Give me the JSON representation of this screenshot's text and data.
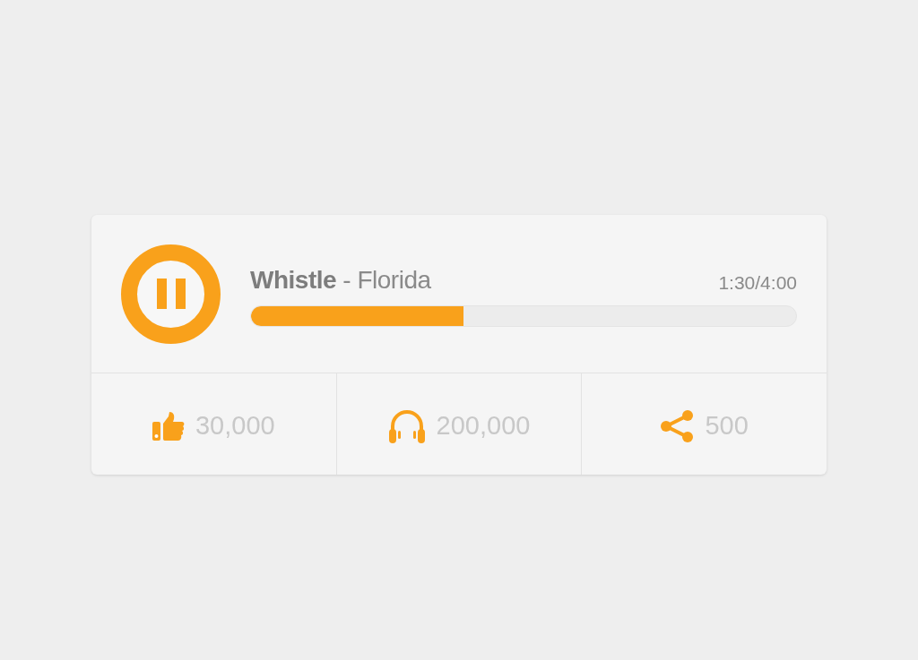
{
  "player": {
    "playing": true,
    "title": "**Whistle** - Florida",
    "time": "1:30/4:00",
    "level": 0.39
  },
  "stats": [
    {
      "kind": "likes",
      "count": "30,000"
    },
    {
      "kind": "listens",
      "count": "200,000"
    },
    {
      "kind": "shares",
      "count": "500"
    }
  ]
}
